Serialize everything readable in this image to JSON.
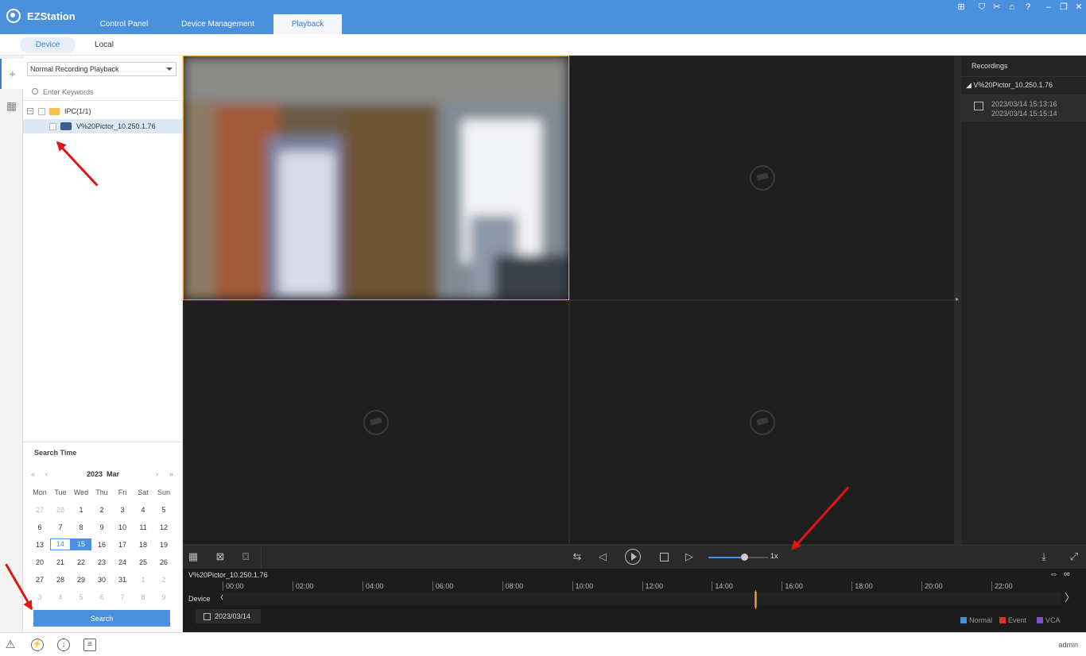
{
  "app": {
    "title": "EZStation"
  },
  "main_tabs": [
    {
      "label": "Control Panel"
    },
    {
      "label": "Device Management"
    },
    {
      "label": "Playback",
      "active": true
    }
  ],
  "title_icons": [
    "grid-view-icon",
    "shirt-icon",
    "scissors-icon",
    "lock-icon",
    "help-icon",
    "minimize-icon",
    "restore-icon",
    "close-icon"
  ],
  "sub_tabs": [
    {
      "label": "Device",
      "active": true
    },
    {
      "label": "Local"
    }
  ],
  "left": {
    "playback_mode": "Normal Recording Playback",
    "search_placeholder": "Enter Keywords",
    "tree": {
      "group": "IPC(1/1)",
      "device": "V%20Pictor_10.250.1.76"
    }
  },
  "search_time": {
    "title": "Search Time",
    "year": "2023",
    "month": "Mar",
    "nav": {
      "prev_year": "«",
      "prev_month": "‹",
      "next_month": "›",
      "next_year": "»"
    },
    "weekdays": [
      "Mon",
      "Tue",
      "Wed",
      "Thu",
      "Fri",
      "Sat",
      "Sun"
    ],
    "days": [
      {
        "d": "27",
        "om": true
      },
      {
        "d": "28",
        "om": true
      },
      {
        "d": "1"
      },
      {
        "d": "2"
      },
      {
        "d": "3"
      },
      {
        "d": "4"
      },
      {
        "d": "5"
      },
      {
        "d": "6"
      },
      {
        "d": "7"
      },
      {
        "d": "8"
      },
      {
        "d": "9"
      },
      {
        "d": "10"
      },
      {
        "d": "11"
      },
      {
        "d": "12"
      },
      {
        "d": "13"
      },
      {
        "d": "14",
        "today": true
      },
      {
        "d": "15",
        "selected": true
      },
      {
        "d": "16"
      },
      {
        "d": "17"
      },
      {
        "d": "18"
      },
      {
        "d": "19"
      },
      {
        "d": "20"
      },
      {
        "d": "21"
      },
      {
        "d": "22"
      },
      {
        "d": "23"
      },
      {
        "d": "24"
      },
      {
        "d": "25"
      },
      {
        "d": "26"
      },
      {
        "d": "27"
      },
      {
        "d": "28"
      },
      {
        "d": "29"
      },
      {
        "d": "30"
      },
      {
        "d": "31"
      },
      {
        "d": "1",
        "om": true
      },
      {
        "d": "2",
        "om": true
      },
      {
        "d": "3",
        "om": true
      },
      {
        "d": "4",
        "om": true
      },
      {
        "d": "5",
        "om": true
      },
      {
        "d": "6",
        "om": true
      },
      {
        "d": "7",
        "om": true
      },
      {
        "d": "8",
        "om": true
      },
      {
        "d": "9",
        "om": true
      }
    ],
    "search_button": "Search"
  },
  "recordings": {
    "title": "Recordings",
    "device": "V%20Pictor_10.250.1.76",
    "start": "2023/03/14  15:13:16",
    "end": "2023/03/14  15:15:14"
  },
  "playback": {
    "speed": "1x",
    "speed_level": 0.6
  },
  "timeline": {
    "camera": "V%20Pictor_10.250.1.76",
    "row_label": "Device",
    "date": "2023/03/14",
    "hours": [
      "00:00",
      "02:00",
      "04:00",
      "06:00",
      "08:00",
      "10:00",
      "12:00",
      "14:00",
      "16:00",
      "18:00",
      "20:00",
      "22:00"
    ],
    "recording_hour": 15.25,
    "legend": [
      {
        "label": "Normal",
        "color": "#4a90dc"
      },
      {
        "label": "Event",
        "color": "#e03131"
      },
      {
        "label": "VCA",
        "color": "#7b4fd6"
      }
    ]
  },
  "status": {
    "user": "admin"
  },
  "colors": {
    "accent": "#4a90dc",
    "active_pane": "#e8a33a",
    "annotation": "#e01616"
  }
}
